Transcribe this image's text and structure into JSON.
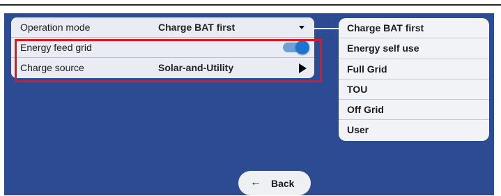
{
  "settings": {
    "rows": [
      {
        "label": "Operation mode",
        "value": "Charge BAT first",
        "control": "dropdown-caret"
      },
      {
        "label": "Energy feed grid",
        "value": "",
        "control": "toggle",
        "toggle_on": true
      },
      {
        "label": "Charge source",
        "value": "Solar-and-Utility",
        "control": "play-arrow"
      }
    ]
  },
  "operation_mode_options": [
    "Charge BAT first",
    "Energy self use",
    "Full Grid",
    "TOU",
    "Off Grid",
    "User"
  ],
  "back_button": {
    "icon": "arrow-left-icon",
    "label": "Back"
  },
  "colors": {
    "background": "#2d4b93",
    "panel": "#e9ecf2",
    "toggle_accent": "#1a75d1",
    "highlight": "#e8141b"
  }
}
